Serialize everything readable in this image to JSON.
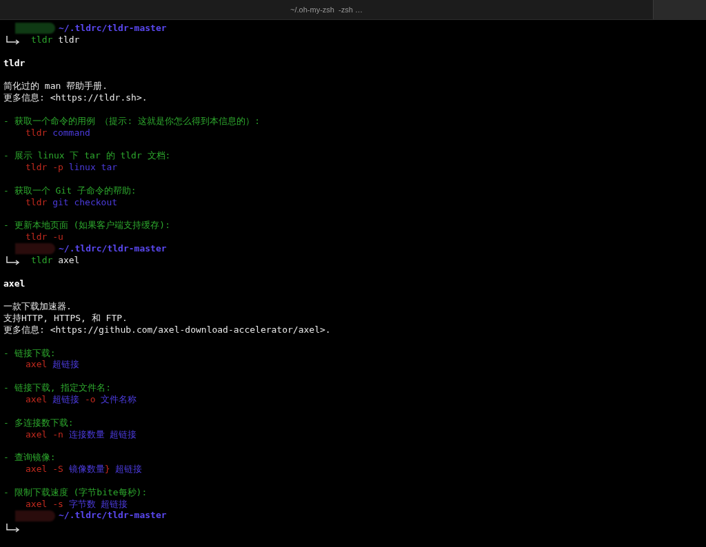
{
  "window": {
    "title": "~/.oh-my-zsh  -zsh …"
  },
  "sessions": [
    {
      "prompt": {
        "color": "#0f3a14",
        "path": "~/.tldrc/tldr-master"
      },
      "command": {
        "program": "tldr",
        "argument": "tldr"
      },
      "output": {
        "title": "tldr",
        "description": [
          "简化过的 man 帮助手册.",
          "更多信息: <https://tldr.sh>."
        ],
        "examples": [
          {
            "description": "- 获取一个命令的用例 （提示: 这就是你怎么得到本信息的）:",
            "command": [
              {
                "kind": "program",
                "text": "tldr"
              },
              {
                "kind": "argument",
                "text": "command"
              }
            ]
          },
          {
            "description": "- 展示 linux 下 tar 的 tldr 文档:",
            "command": [
              {
                "kind": "program",
                "text": "tldr -p"
              },
              {
                "kind": "argument",
                "text": "linux tar"
              }
            ]
          },
          {
            "description": "- 获取一个 Git 子命令的帮助:",
            "command": [
              {
                "kind": "program",
                "text": "tldr"
              },
              {
                "kind": "argument",
                "text": "git checkout"
              }
            ]
          },
          {
            "description": "- 更新本地页面 (如果客户端支持缓存):",
            "command": [
              {
                "kind": "program",
                "text": "tldr -u"
              }
            ]
          }
        ]
      }
    },
    {
      "prompt": {
        "color": "#2a0c0c",
        "path": "~/.tldrc/tldr-master"
      },
      "command": {
        "program": "tldr",
        "argument": "axel"
      },
      "output": {
        "title": "axel",
        "description": [
          "一款下载加速器.",
          "支持HTTP, HTTPS, 和 FTP.",
          "更多信息: <https://github.com/axel-download-accelerator/axel>."
        ],
        "examples": [
          {
            "description": "- 链接下载:",
            "command": [
              {
                "kind": "program",
                "text": "axel"
              },
              {
                "kind": "argument",
                "text": "超链接"
              }
            ]
          },
          {
            "description": "- 链接下载, 指定文件名:",
            "command": [
              {
                "kind": "program",
                "text": "axel"
              },
              {
                "kind": "argument",
                "text": "超链接"
              },
              {
                "kind": "program",
                "text": "-o"
              },
              {
                "kind": "argument",
                "text": "文件名称"
              }
            ]
          },
          {
            "description": "- 多连接数下载:",
            "command": [
              {
                "kind": "program",
                "text": "axel -n"
              },
              {
                "kind": "argument",
                "text": "连接数量 超链接"
              }
            ]
          },
          {
            "description": "- 查询镜像:",
            "command": [
              {
                "kind": "program",
                "text": "axel -S"
              },
              {
                "kind": "argument",
                "text": "镜像数量"
              },
              {
                "kind": "program",
                "text": "}",
                "join": true
              },
              {
                "kind": "argument",
                "text": "超链接"
              }
            ]
          },
          {
            "description": "- 限制下载速度 (字节bite每秒):",
            "command": [
              {
                "kind": "program",
                "text": "axel -s"
              },
              {
                "kind": "argument",
                "text": "字节数 超链接"
              }
            ]
          }
        ]
      }
    },
    {
      "prompt": {
        "color": "#2a0c0c",
        "path": "~/.tldrc/tldr-master"
      }
    }
  ]
}
